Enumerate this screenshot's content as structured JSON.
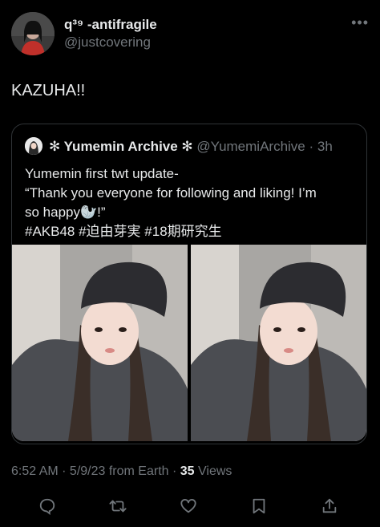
{
  "tweet": {
    "display_name": "q³⁹ -antifragile",
    "handle": "@justcovering",
    "text": "KAZUHA!!",
    "more_icon": "more-icon",
    "timestamp": "6:52 AM · 5/9/23 from Earth · ",
    "views_count": "35",
    "views_label": " Views"
  },
  "quote": {
    "name": "✻ Yumemin Archive ✻",
    "handle": "@YumemiArchive",
    "time": " · 3h",
    "lines": [
      "Yumemin first twt update-",
      "“Thank you everyone for following and liking! I’m",
      "so happy🦭!”",
      "#AKB48 #迫由芽実 #18期研究生"
    ]
  },
  "actions": [
    "reply-icon",
    "retweet-icon",
    "like-icon",
    "bookmark-icon",
    "share-icon"
  ],
  "colors": {
    "background": "#000000",
    "text": "#e7e9ea",
    "secondary": "#71767b",
    "border": "#2f3336"
  }
}
